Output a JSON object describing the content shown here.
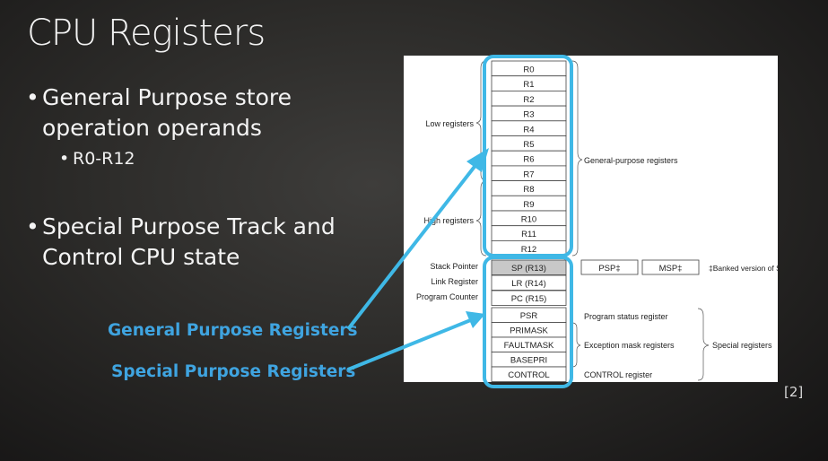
{
  "slide": {
    "title": "CPU Registers",
    "bullet1": "General Purpose store operation operands",
    "bullet1_sub": "R0-R12",
    "bullet2": "Special Purpose Track and Control CPU state",
    "callout_general": "General Purpose Registers",
    "callout_special": "Special Purpose Registers",
    "citation": "[2]",
    "accent_color": "#3fb8e6",
    "callout_color": "#3fa4e0"
  },
  "diagram": {
    "general_registers": [
      "R0",
      "R1",
      "R2",
      "R3",
      "R4",
      "R5",
      "R6",
      "R7",
      "R8",
      "R9",
      "R10",
      "R11",
      "R12"
    ],
    "low_registers_label": "Low registers",
    "high_registers_label": "High registers",
    "general_purpose_label": "General-purpose registers",
    "stack_pointer_label": "Stack Pointer",
    "link_register_label": "Link Register",
    "program_counter_label": "Program Counter",
    "sp": "SP (R13)",
    "lr": "LR (R14)",
    "pc": "PC (R15)",
    "psp": "PSP‡",
    "msp": "MSP‡",
    "banked_note": "‡Banked version of SP",
    "special_registers": [
      "PSR",
      "PRIMASK",
      "FAULTMASK",
      "BASEPRI",
      "CONTROL"
    ],
    "psr_label": "Program status register",
    "exception_mask_label": "Exception mask registers",
    "control_label": "CONTROL register",
    "special_registers_label": "Special registers"
  }
}
